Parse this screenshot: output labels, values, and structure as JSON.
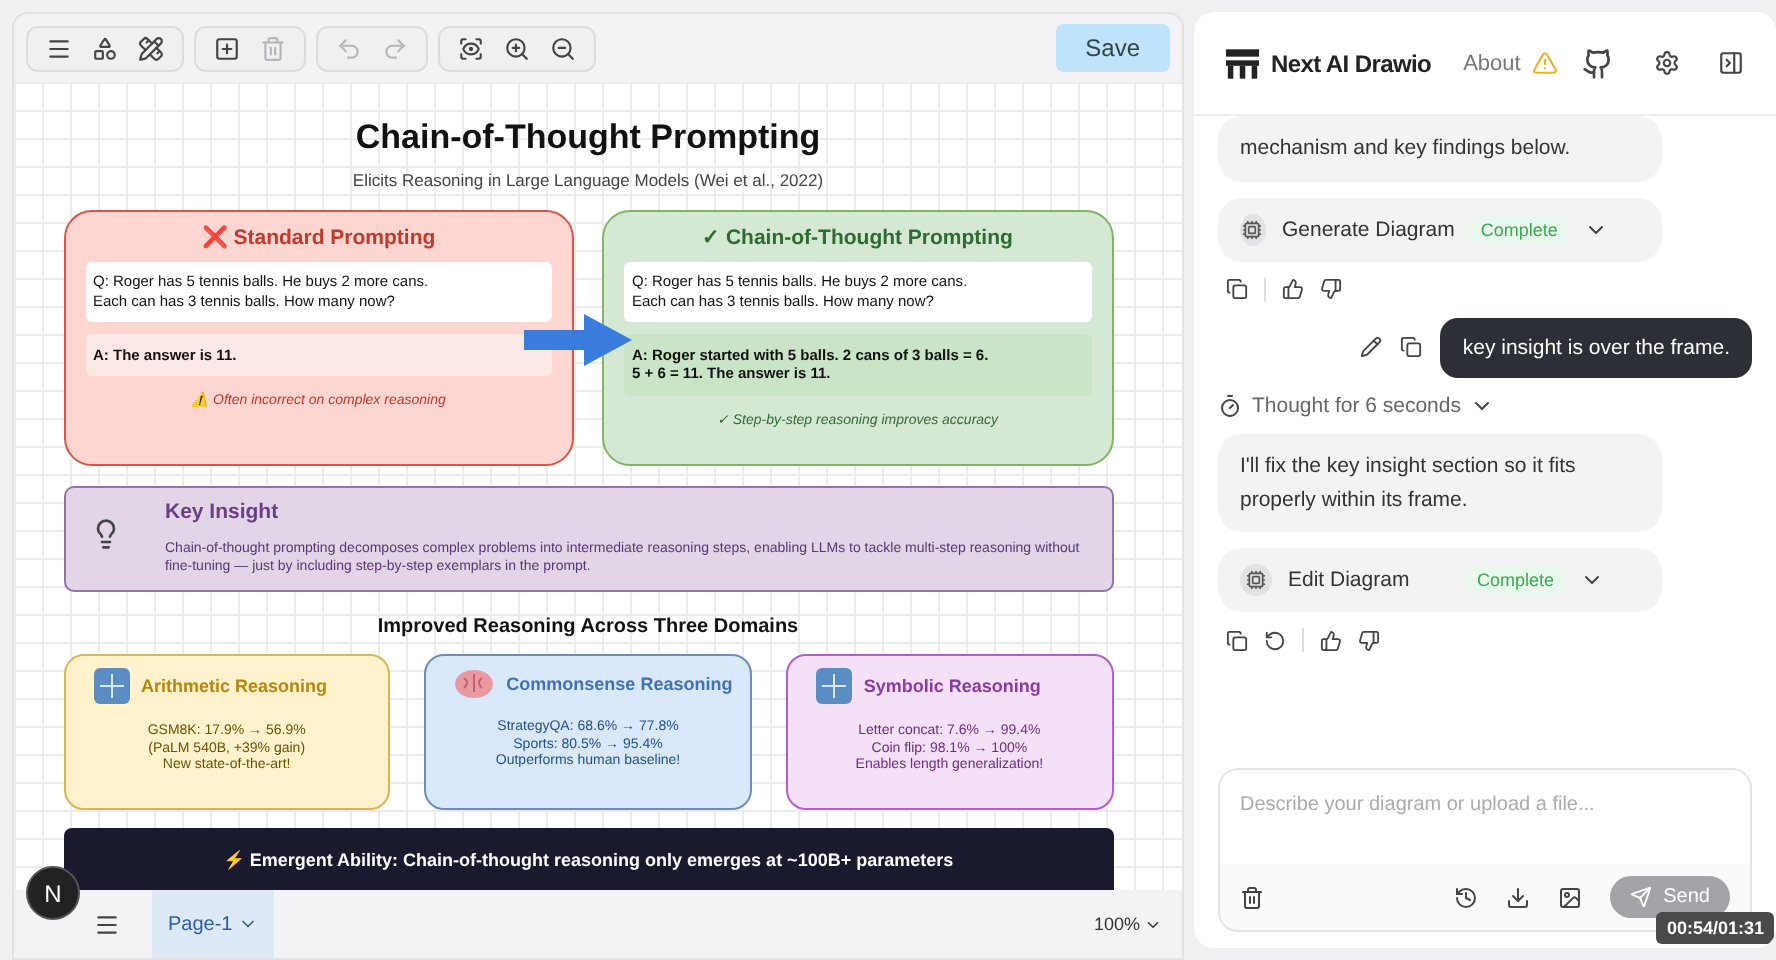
{
  "toolbar": {
    "save": "Save"
  },
  "diagram": {
    "title": "Chain-of-Thought Prompting",
    "subtitle": "Elicits Reasoning in Large Language Models (Wei et al., 2022)",
    "panels": [
      {
        "kind": "standard",
        "title": "❌ Standard Prompting",
        "question": "Q: Roger has 5 tennis balls. He buys 2 more cans.\nEach can has 3 tennis balls. How many now?",
        "answer": "A: The answer is 11.",
        "note": "⚠️ Often incorrect on complex reasoning"
      },
      {
        "kind": "cot",
        "title": "✓ Chain-of-Thought Prompting",
        "question": "Q: Roger has 5 tennis balls. He buys 2 more cans.\nEach can has 3 tennis balls. How many now?",
        "answer": "A: Roger started with 5 balls. 2 cans of 3 balls = 6.\n5 + 6 = 11. The answer is 11.",
        "note": "✓ Step-by-step reasoning improves accuracy"
      }
    ],
    "insight": {
      "title": "Key Insight",
      "text": "Chain-of-thought prompting decomposes complex problems into intermediate reasoning steps, enabling LLMs to tackle multi-step reasoning without fine-tuning — just by including step-by-step exemplars in the prompt."
    },
    "domains_title": "Improved Reasoning Across Three Domains",
    "domains": [
      {
        "kind": "arithmetic",
        "title": "Arithmetic Reasoning",
        "lines": [
          "GSM8K: 17.9% → 56.9%",
          "(PaLM 540B, +39% gain)",
          "New state-of-the-art!"
        ]
      },
      {
        "kind": "commonsense",
        "title": "Commonsense Reasoning",
        "lines": [
          "StrategyQA: 68.6% → 77.8%",
          "Sports: 80.5% → 95.4%",
          "Outperforms human baseline!"
        ]
      },
      {
        "kind": "symbolic",
        "title": "Symbolic Reasoning",
        "lines": [
          "Letter concat: 7.6% → 99.4%",
          "Coin flip: 98.1% → 100%",
          "Enables length generalization!"
        ]
      }
    ],
    "banner": "⚡ Emergent Ability: Chain-of-thought reasoning only emerges at ~100B+ parameters"
  },
  "bottom_bar": {
    "avatar": "N",
    "page_tab": {
      "label": "Page-1",
      "selected": true
    },
    "zoom": "100%"
  },
  "chat": {
    "app_name": "Next AI Drawio",
    "about": "About",
    "messages": [
      {
        "kind": "assistant",
        "text": "mechanism and key findings below."
      },
      {
        "kind": "tool",
        "name": "Generate Diagram",
        "status": "Complete"
      },
      {
        "kind": "actions",
        "retry": false
      },
      {
        "kind": "user",
        "text": "key insight is over the frame."
      },
      {
        "kind": "thought",
        "text": "Thought for 6 seconds"
      },
      {
        "kind": "assistant",
        "text": "I'll fix the key insight section so it fits properly within its frame."
      },
      {
        "kind": "tool",
        "name": "Edit Diagram",
        "status": "Complete"
      },
      {
        "kind": "actions",
        "retry": true
      }
    ],
    "input": {
      "placeholder": "Describe your diagram or upload a file..."
    },
    "send": "Send"
  },
  "video_time": "00:54/01:31"
}
